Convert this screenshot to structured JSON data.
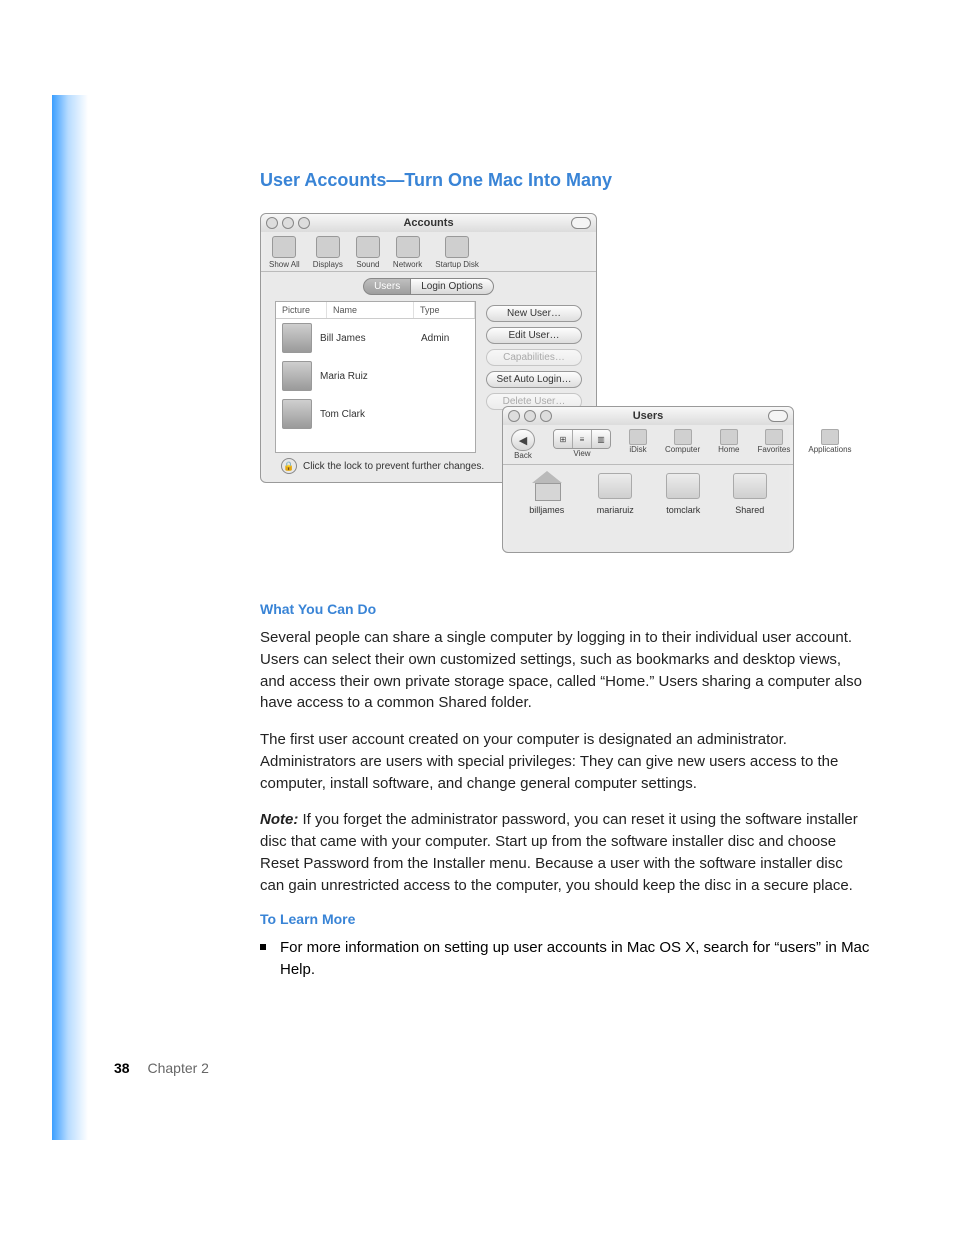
{
  "title": "User Accounts—Turn One Mac Into Many",
  "accounts_window": {
    "title": "Accounts",
    "toolbar": [
      {
        "label": "Show All"
      },
      {
        "label": "Displays"
      },
      {
        "label": "Sound"
      },
      {
        "label": "Network"
      },
      {
        "label": "Startup Disk"
      }
    ],
    "tabs": {
      "users": "Users",
      "login": "Login Options"
    },
    "columns": {
      "picture": "Picture",
      "name": "Name",
      "type": "Type"
    },
    "users": [
      {
        "name": "Bill James",
        "type": "Admin"
      },
      {
        "name": "Maria Ruiz",
        "type": ""
      },
      {
        "name": "Tom Clark",
        "type": ""
      }
    ],
    "buttons": {
      "new": "New User…",
      "edit": "Edit User…",
      "cap": "Capabilities…",
      "auto": "Set Auto Login…",
      "del": "Delete User…"
    },
    "lock": "Click the lock to prevent further changes."
  },
  "finder_window": {
    "title": "Users",
    "toolbar": {
      "back": "Back",
      "view": "View",
      "items": [
        "iDisk",
        "Computer",
        "Home",
        "Favorites",
        "Applications"
      ]
    },
    "folders": [
      "billjames",
      "mariaruiz",
      "tomclark",
      "Shared"
    ]
  },
  "section1_heading": "What You Can Do",
  "para1": "Several people can share a single computer by logging in to their individual user account. Users can select their own customized settings, such as bookmarks and desktop views, and access their own private storage space, called “Home.” Users sharing a computer also have access to a common Shared folder.",
  "para2": "The first user account created on your computer is designated an administrator. Administrators are users with special privileges:  They can give new users access to the computer, install software, and change general computer settings.",
  "note_label": "Note:",
  "para3": "  If you forget the administrator password, you can reset it using the software installer disc that came with your computer. Start up from the software installer disc and choose Reset Password from the Installer menu. Because a user with the software installer disc can gain unrestricted access to the computer, you should keep the disc in a secure place.",
  "section2_heading": "To Learn More",
  "bullet1": "For more information on setting up user accounts in Mac OS X, search for “users” in Mac Help.",
  "page_number": "38",
  "chapter": "Chapter  2"
}
